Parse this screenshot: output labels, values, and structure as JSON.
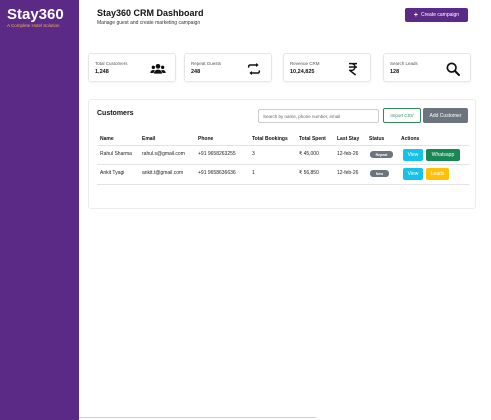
{
  "sidebar": {
    "brand": "Stay360",
    "tagline": "A Complete Hotel Solution"
  },
  "header": {
    "title": "Stay360 CRM Dashboard",
    "subtitle": "Manage guest and create marketing campaign",
    "create_campaign_label": "Create campaign"
  },
  "stats": [
    {
      "label": "Total Customers",
      "value": "1,248",
      "icon": "users-icon"
    },
    {
      "label": "Repeat Guests",
      "value": "248",
      "icon": "repeat-icon"
    },
    {
      "label": "Revenue CRM",
      "value": "10,24,825",
      "icon": "rupee-icon"
    },
    {
      "label": "Search Leads",
      "value": "128",
      "icon": "search-icon"
    }
  ],
  "customers": {
    "title": "Customers",
    "search_placeholder": "Search by name, phone number, email",
    "import_label": "Import CSV",
    "add_label": "Add Customer",
    "columns": [
      "Name",
      "Email",
      "Phone",
      "Total Bookings",
      "Total Spent",
      "Last Stay",
      "Status",
      "Actions"
    ],
    "rows": [
      {
        "name": "Rahul Sharma",
        "email": "rahul.s@gmail.com",
        "phone": "+91 9658263255",
        "bookings": "3",
        "spent": "₹ 45,000",
        "last_stay": "12-feb-26",
        "status": "Repeat",
        "view": "View",
        "action2": "Whatsapp"
      },
      {
        "name": "Ankit Tyagi",
        "email": "ankit.t@gmail.com",
        "phone": "+91 9658636636",
        "bookings": "1",
        "spent": "₹ 56,850",
        "last_stay": "12-feb-26",
        "status": "New",
        "view": "View",
        "action2": "Leads"
      }
    ]
  },
  "colors": {
    "sidebar": "#5b2a86",
    "accent": "#f0b341",
    "view": "#17c1e8",
    "whatsapp": "#198754",
    "leads": "#ffc107"
  }
}
